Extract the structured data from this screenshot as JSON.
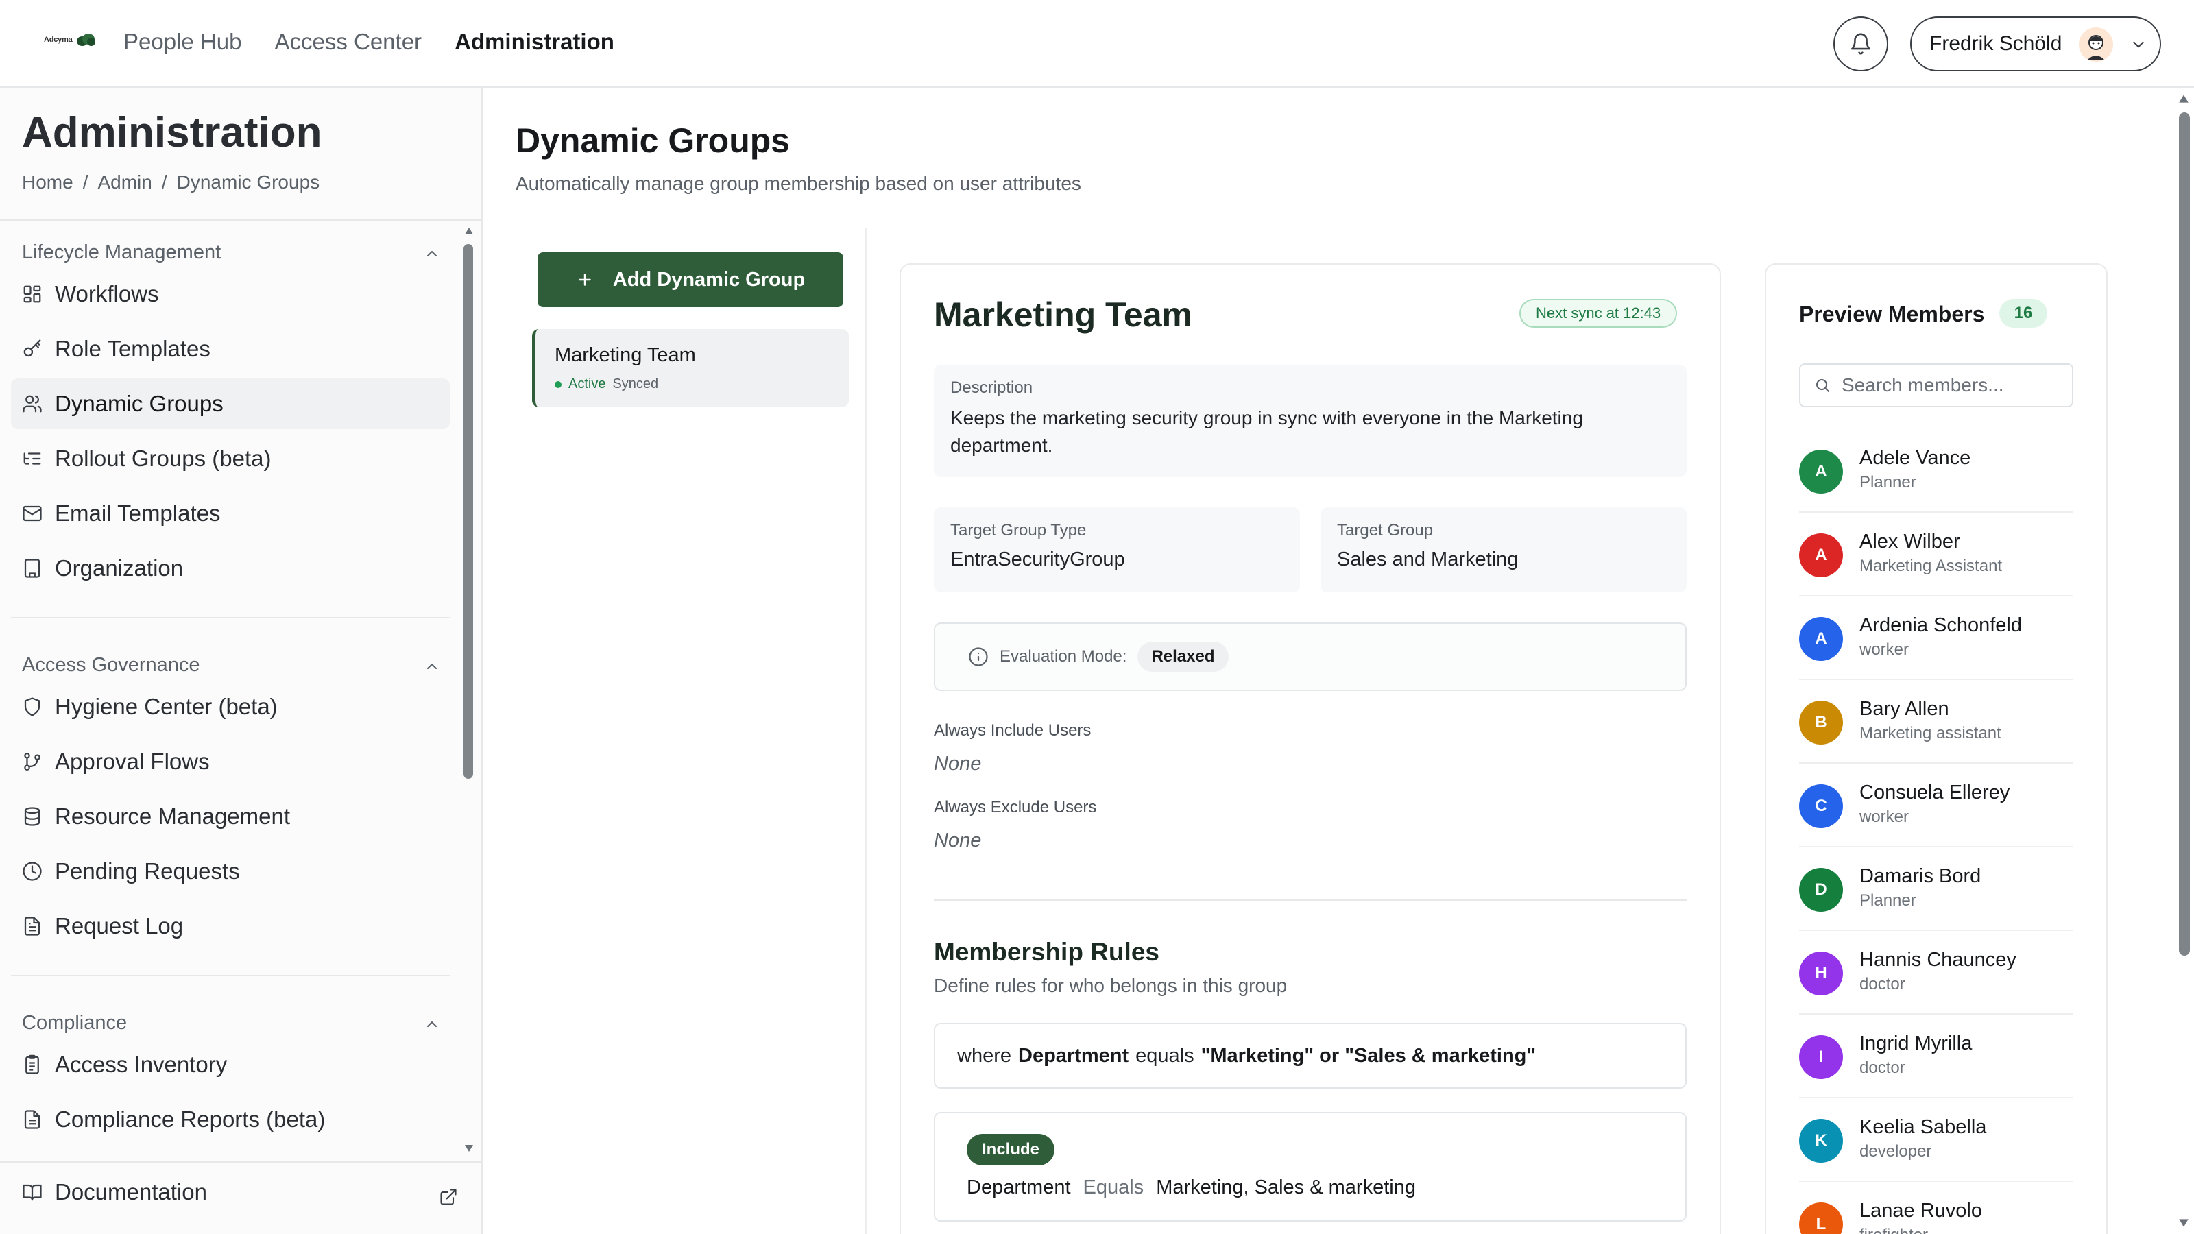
{
  "app": {
    "logo_text": "Adcyma",
    "nav": [
      {
        "label": "People Hub",
        "active": false
      },
      {
        "label": "Access Center",
        "active": false
      },
      {
        "label": "Administration",
        "active": true
      }
    ],
    "user_name": "Fredrik Schöld"
  },
  "sidebar": {
    "title": "Administration",
    "breadcrumb": [
      "Home",
      "Admin",
      "Dynamic Groups"
    ],
    "sections": [
      {
        "label": "Lifecycle Management",
        "items": [
          {
            "label": "Workflows",
            "icon": "workflows-icon"
          },
          {
            "label": "Role Templates",
            "icon": "key-icon"
          },
          {
            "label": "Dynamic Groups",
            "icon": "users-icon",
            "active": true
          },
          {
            "label": "Rollout Groups (beta)",
            "icon": "list-tree-icon"
          },
          {
            "label": "Email Templates",
            "icon": "mail-icon"
          },
          {
            "label": "Organization",
            "icon": "building-icon"
          }
        ]
      },
      {
        "label": "Access Governance",
        "items": [
          {
            "label": "Hygiene Center (beta)",
            "icon": "shield-icon"
          },
          {
            "label": "Approval Flows",
            "icon": "git-branch-icon"
          },
          {
            "label": "Resource Management",
            "icon": "database-icon"
          },
          {
            "label": "Pending Requests",
            "icon": "clock-icon"
          },
          {
            "label": "Request Log",
            "icon": "file-text-icon"
          }
        ]
      },
      {
        "label": "Compliance",
        "items": [
          {
            "label": "Access Inventory",
            "icon": "clipboard-icon"
          },
          {
            "label": "Compliance Reports (beta)",
            "icon": "file-text-icon"
          }
        ]
      }
    ],
    "footer_item": "Documentation"
  },
  "main": {
    "title": "Dynamic Groups",
    "subtitle": "Automatically manage group membership based on user attributes",
    "add_button": "Add Dynamic Group",
    "groups": [
      {
        "name": "Marketing Team",
        "status": "Active",
        "sync": "Synced"
      }
    ]
  },
  "detail": {
    "title": "Marketing Team",
    "sync_badge": "Next sync at 12:43",
    "description_label": "Description",
    "description": "Keeps the marketing security group in sync with everyone in the Marketing department.",
    "target_type_label": "Target Group Type",
    "target_type": "EntraSecurityGroup",
    "target_group_label": "Target Group",
    "target_group": "Sales and Marketing",
    "eval_label": "Evaluation Mode:",
    "eval_mode": "Relaxed",
    "include_users_label": "Always Include Users",
    "include_users": "None",
    "exclude_users_label": "Always Exclude Users",
    "exclude_users": "None",
    "rules_title": "Membership Rules",
    "rules_subtitle": "Define rules for who belongs in this group",
    "rule_summary": {
      "where": "where",
      "attribute": "Department",
      "op": "equals",
      "values": "\"Marketing\" or \"Sales & marketing\""
    },
    "rule_card": {
      "pill": "Include",
      "attribute": "Department",
      "op": "Equals",
      "values": "Marketing, Sales & marketing"
    }
  },
  "preview": {
    "title": "Preview Members",
    "count": "16",
    "search_placeholder": "Search members...",
    "members": [
      {
        "initial": "A",
        "name": "Adele Vance",
        "role": "Planner",
        "color": "#1e8a4a"
      },
      {
        "initial": "A",
        "name": "Alex Wilber",
        "role": "Marketing Assistant",
        "color": "#dc2626"
      },
      {
        "initial": "A",
        "name": "Ardenia Schonfeld",
        "role": "worker",
        "color": "#2563eb"
      },
      {
        "initial": "B",
        "name": "Bary Allen",
        "role": "Marketing assistant",
        "color": "#ca8a04"
      },
      {
        "initial": "C",
        "name": "Consuela Ellerey",
        "role": "worker",
        "color": "#2563eb"
      },
      {
        "initial": "D",
        "name": "Damaris Bord",
        "role": "Planner",
        "color": "#15803d"
      },
      {
        "initial": "H",
        "name": "Hannis Chauncey",
        "role": "doctor",
        "color": "#9333ea"
      },
      {
        "initial": "I",
        "name": "Ingrid Myrilla",
        "role": "doctor",
        "color": "#9333ea"
      },
      {
        "initial": "K",
        "name": "Keelia Sabella",
        "role": "developer",
        "color": "#0891b2"
      },
      {
        "initial": "L",
        "name": "Lanae Ruvolo",
        "role": "firefighter",
        "color": "#ea580c"
      }
    ]
  }
}
